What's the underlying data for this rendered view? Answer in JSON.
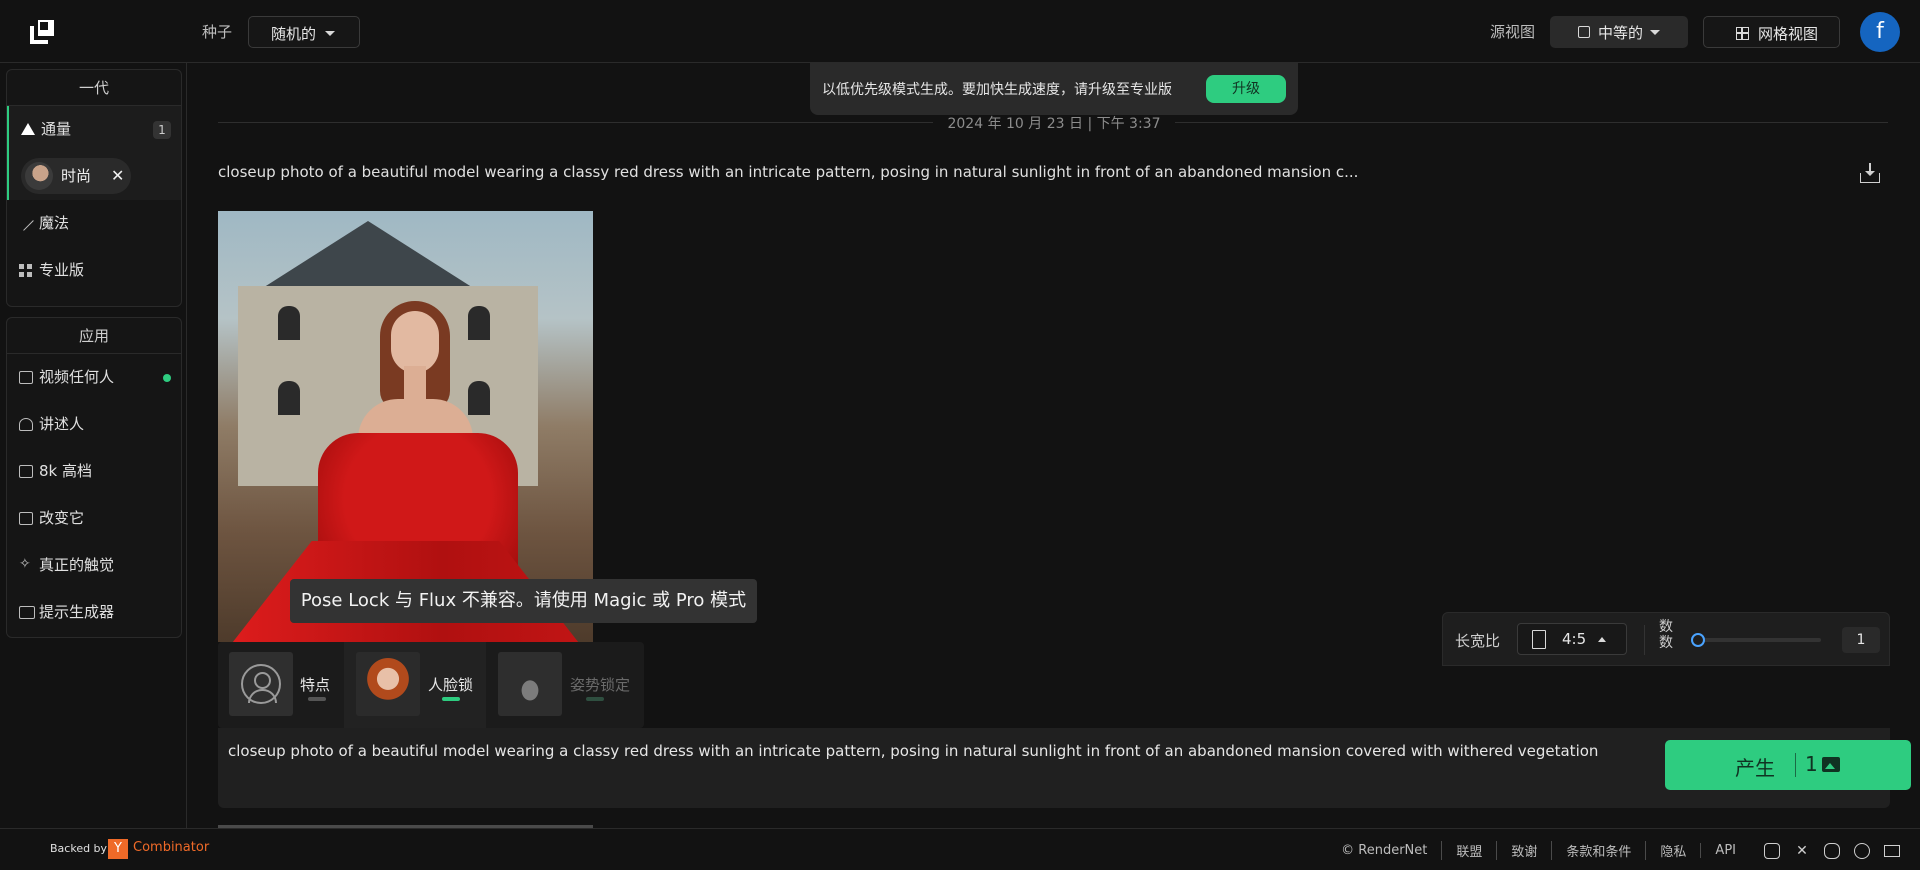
{
  "topbar": {
    "seed_label": "种子",
    "seed_value": "随机的",
    "source_view_label": "源视图",
    "size_value": "中等的",
    "grid_view_label": "网格视图",
    "avatar_letter": "f"
  },
  "sidebar": {
    "generation_title": "一代",
    "generation_items": [
      {
        "label": "通量",
        "icon": "triangle-icon",
        "badge": "1"
      },
      {
        "label": "魔法",
        "icon": "magic-wand-icon"
      },
      {
        "label": "专业版",
        "icon": "grid-icon"
      }
    ],
    "style_chip": {
      "label": "时尚",
      "close": "✕"
    },
    "apps_title": "应用",
    "app_items": [
      {
        "label": "视频任何人",
        "icon": "folder-icon",
        "status": "active"
      },
      {
        "label": "讲述人",
        "icon": "narrator-icon"
      },
      {
        "label": "8k 高档",
        "icon": "8k-icon"
      },
      {
        "label": "改变它",
        "icon": "swap-icon"
      },
      {
        "label": "真正的触觉",
        "icon": "sparkle-icon"
      },
      {
        "label": "提示生成器",
        "icon": "terminal-icon"
      }
    ]
  },
  "notice": {
    "text": "以低优先级模式生成。要加快生成速度，请升级至专业版",
    "button": "升级"
  },
  "feed": {
    "date": "2024 年 10 月 23 日 | 下午 3:37",
    "prompt": "closeup photo of a beautiful model wearing a classy red dress with an intricate pattern, posing in natural sunlight in front of an abandoned mansion c..."
  },
  "tooltip": "Pose Lock 与 Flux 不兼容。请使用 Magic 或 Pro 模式",
  "locks": [
    {
      "label": "特点",
      "state": "off"
    },
    {
      "label": "人脸锁",
      "state": "on"
    },
    {
      "label": "姿势锁定",
      "state": "disabled"
    }
  ],
  "colors": {
    "accent": "#2ecc80",
    "background": "#121212",
    "panel": "#202020",
    "avatar": "#1565c0",
    "yc": "#ef6a28"
  },
  "settings": {
    "ratio_label": "长宽比",
    "ratio_value": "4:5",
    "count_label": "数数",
    "count_value": "1",
    "count_fraction": 0
  },
  "composer": {
    "prompt": "closeup photo of a beautiful model wearing a classy red dress with an intricate pattern, posing in natural sunlight in front of an abandoned mansion covered with withered vegetation",
    "generate_label": "产生",
    "generate_count": "1"
  },
  "footer": {
    "backed_by": "Backed by",
    "yc_letter": "Y",
    "yc_name": "Combinator",
    "links": [
      "© RenderNet",
      "联盟",
      "致谢",
      "条款和条件",
      "隐私",
      "API"
    ],
    "social_icons": [
      "instagram-icon",
      "x-icon",
      "discord-icon",
      "reddit-icon",
      "mail-icon"
    ]
  }
}
